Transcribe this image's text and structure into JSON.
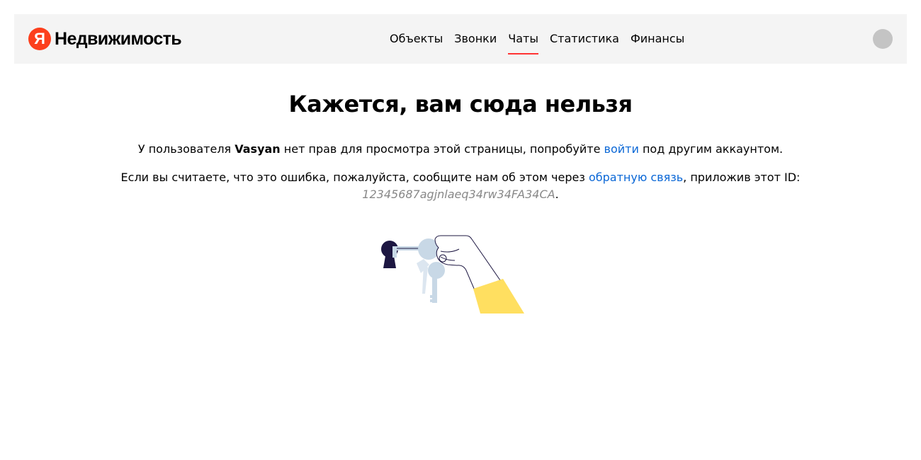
{
  "header": {
    "logo_letter": "Я",
    "logo_text": "Недвижимость",
    "nav": [
      {
        "label": "Объекты",
        "active": false
      },
      {
        "label": "Звонки",
        "active": false
      },
      {
        "label": "Чаты",
        "active": true
      },
      {
        "label": "Статистика",
        "active": false
      },
      {
        "label": "Финансы",
        "active": false
      }
    ]
  },
  "main": {
    "title": "Кажется, вам сюда нельзя",
    "line1": {
      "before": "У пользователя ",
      "user": "Vasyan",
      "middle": " нет прав для просмотра этой страницы, попробуйте ",
      "login_link": "войти",
      "after": " под другим аккаунтом."
    },
    "line2": {
      "before": "Если вы считаете, что это ошибка, пожалуйста, сообщите нам об этом через ",
      "feedback_link": "обратную связь",
      "after": ", приложив этот ID:",
      "request_id": "12345687agjnlaeq34rw34FA34CA",
      "end": "."
    }
  },
  "colors": {
    "accent": "#fc3f1d",
    "link": "#0a67d6",
    "nav_underline": "#ff3333",
    "header_bg": "#f4f4f4",
    "illustration_yellow": "#ffdf60",
    "illustration_dark": "#1d1742",
    "illustration_light": "#c8d8e6"
  },
  "icons": {
    "illustration": "hand-holding-key-to-keyhole",
    "avatar": "user-avatar-placeholder"
  }
}
